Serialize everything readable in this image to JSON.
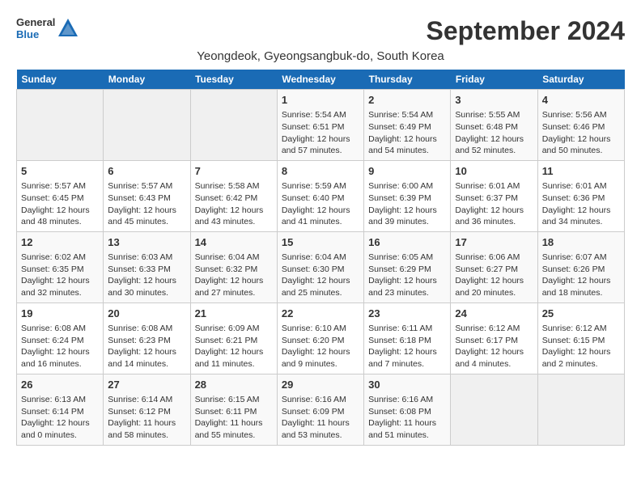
{
  "header": {
    "logo_general": "General",
    "logo_blue": "Blue",
    "month_title": "September 2024",
    "location": "Yeongdeok, Gyeongsangbuk-do, South Korea"
  },
  "weekdays": [
    "Sunday",
    "Monday",
    "Tuesday",
    "Wednesday",
    "Thursday",
    "Friday",
    "Saturday"
  ],
  "days": [
    {
      "day": "",
      "info": ""
    },
    {
      "day": "",
      "info": ""
    },
    {
      "day": "",
      "info": ""
    },
    {
      "day": "1",
      "info": "Sunrise: 5:54 AM\nSunset: 6:51 PM\nDaylight: 12 hours\nand 57 minutes."
    },
    {
      "day": "2",
      "info": "Sunrise: 5:54 AM\nSunset: 6:49 PM\nDaylight: 12 hours\nand 54 minutes."
    },
    {
      "day": "3",
      "info": "Sunrise: 5:55 AM\nSunset: 6:48 PM\nDaylight: 12 hours\nand 52 minutes."
    },
    {
      "day": "4",
      "info": "Sunrise: 5:56 AM\nSunset: 6:46 PM\nDaylight: 12 hours\nand 50 minutes."
    },
    {
      "day": "5",
      "info": "Sunrise: 5:57 AM\nSunset: 6:45 PM\nDaylight: 12 hours\nand 48 minutes."
    },
    {
      "day": "6",
      "info": "Sunrise: 5:57 AM\nSunset: 6:43 PM\nDaylight: 12 hours\nand 45 minutes."
    },
    {
      "day": "7",
      "info": "Sunrise: 5:58 AM\nSunset: 6:42 PM\nDaylight: 12 hours\nand 43 minutes."
    },
    {
      "day": "8",
      "info": "Sunrise: 5:59 AM\nSunset: 6:40 PM\nDaylight: 12 hours\nand 41 minutes."
    },
    {
      "day": "9",
      "info": "Sunrise: 6:00 AM\nSunset: 6:39 PM\nDaylight: 12 hours\nand 39 minutes."
    },
    {
      "day": "10",
      "info": "Sunrise: 6:01 AM\nSunset: 6:37 PM\nDaylight: 12 hours\nand 36 minutes."
    },
    {
      "day": "11",
      "info": "Sunrise: 6:01 AM\nSunset: 6:36 PM\nDaylight: 12 hours\nand 34 minutes."
    },
    {
      "day": "12",
      "info": "Sunrise: 6:02 AM\nSunset: 6:35 PM\nDaylight: 12 hours\nand 32 minutes."
    },
    {
      "day": "13",
      "info": "Sunrise: 6:03 AM\nSunset: 6:33 PM\nDaylight: 12 hours\nand 30 minutes."
    },
    {
      "day": "14",
      "info": "Sunrise: 6:04 AM\nSunset: 6:32 PM\nDaylight: 12 hours\nand 27 minutes."
    },
    {
      "day": "15",
      "info": "Sunrise: 6:04 AM\nSunset: 6:30 PM\nDaylight: 12 hours\nand 25 minutes."
    },
    {
      "day": "16",
      "info": "Sunrise: 6:05 AM\nSunset: 6:29 PM\nDaylight: 12 hours\nand 23 minutes."
    },
    {
      "day": "17",
      "info": "Sunrise: 6:06 AM\nSunset: 6:27 PM\nDaylight: 12 hours\nand 20 minutes."
    },
    {
      "day": "18",
      "info": "Sunrise: 6:07 AM\nSunset: 6:26 PM\nDaylight: 12 hours\nand 18 minutes."
    },
    {
      "day": "19",
      "info": "Sunrise: 6:08 AM\nSunset: 6:24 PM\nDaylight: 12 hours\nand 16 minutes."
    },
    {
      "day": "20",
      "info": "Sunrise: 6:08 AM\nSunset: 6:23 PM\nDaylight: 12 hours\nand 14 minutes."
    },
    {
      "day": "21",
      "info": "Sunrise: 6:09 AM\nSunset: 6:21 PM\nDaylight: 12 hours\nand 11 minutes."
    },
    {
      "day": "22",
      "info": "Sunrise: 6:10 AM\nSunset: 6:20 PM\nDaylight: 12 hours\nand 9 minutes."
    },
    {
      "day": "23",
      "info": "Sunrise: 6:11 AM\nSunset: 6:18 PM\nDaylight: 12 hours\nand 7 minutes."
    },
    {
      "day": "24",
      "info": "Sunrise: 6:12 AM\nSunset: 6:17 PM\nDaylight: 12 hours\nand 4 minutes."
    },
    {
      "day": "25",
      "info": "Sunrise: 6:12 AM\nSunset: 6:15 PM\nDaylight: 12 hours\nand 2 minutes."
    },
    {
      "day": "26",
      "info": "Sunrise: 6:13 AM\nSunset: 6:14 PM\nDaylight: 12 hours\nand 0 minutes."
    },
    {
      "day": "27",
      "info": "Sunrise: 6:14 AM\nSunset: 6:12 PM\nDaylight: 11 hours\nand 58 minutes."
    },
    {
      "day": "28",
      "info": "Sunrise: 6:15 AM\nSunset: 6:11 PM\nDaylight: 11 hours\nand 55 minutes."
    },
    {
      "day": "29",
      "info": "Sunrise: 6:16 AM\nSunset: 6:09 PM\nDaylight: 11 hours\nand 53 minutes."
    },
    {
      "day": "30",
      "info": "Sunrise: 6:16 AM\nSunset: 6:08 PM\nDaylight: 11 hours\nand 51 minutes."
    },
    {
      "day": "",
      "info": ""
    },
    {
      "day": "",
      "info": ""
    },
    {
      "day": "",
      "info": ""
    },
    {
      "day": "",
      "info": ""
    },
    {
      "day": "",
      "info": ""
    }
  ]
}
